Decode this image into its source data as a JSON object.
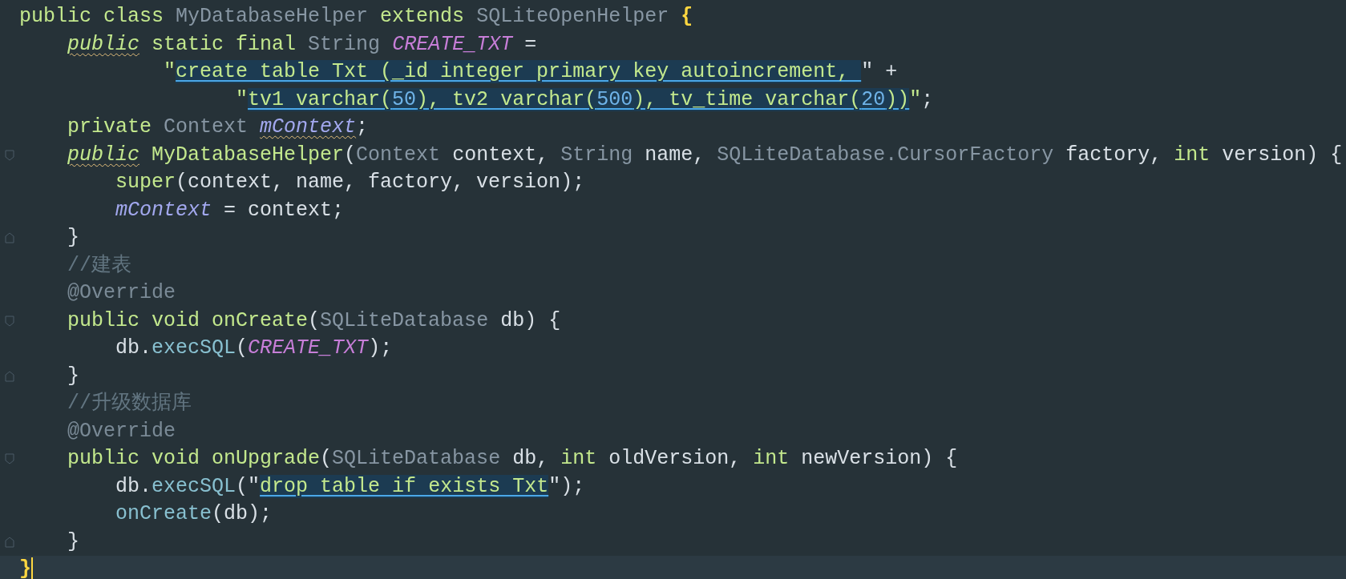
{
  "editor": {
    "lines": [
      {
        "kind": "code",
        "tokens": [
          {
            "text": "public class ",
            "kind": "keyword"
          },
          {
            "text": "MyDatabaseHelper ",
            "kind": "type"
          },
          {
            "text": "extends ",
            "kind": "keyword"
          },
          {
            "text": "SQLiteOpenHelper ",
            "kind": "type"
          },
          {
            "text": "{",
            "kind": "brace"
          }
        ]
      },
      {
        "kind": "code",
        "tokens": [
          {
            "text": "    public",
            "kind": "keyword-warning"
          },
          {
            "text": " static final ",
            "kind": "keyword"
          },
          {
            "text": "String ",
            "kind": "type"
          },
          {
            "text": "CREATE_TXT",
            "kind": "constant"
          },
          {
            "text": " =",
            "kind": "plain"
          }
        ]
      },
      {
        "kind": "code",
        "tokens": [
          {
            "text": "            \"",
            "kind": "string"
          },
          {
            "text": "create table Txt (_id integer primary key autoincrement, ",
            "kind": "sql"
          },
          {
            "text": "\" +",
            "kind": "plain"
          }
        ]
      },
      {
        "kind": "code",
        "tokens": [
          {
            "text": "                  \"",
            "kind": "string"
          },
          {
            "text": "tv1 varchar(",
            "kind": "sql"
          },
          {
            "text": "50",
            "kind": "sql-number"
          },
          {
            "text": "), tv2 varchar(",
            "kind": "sql"
          },
          {
            "text": "500",
            "kind": "sql-number"
          },
          {
            "text": "), tv_time varchar(",
            "kind": "sql"
          },
          {
            "text": "20",
            "kind": "sql-number"
          },
          {
            "text": "))",
            "kind": "sql"
          },
          {
            "text": "\"",
            "kind": "string"
          },
          {
            "text": ";",
            "kind": "plain"
          }
        ]
      },
      {
        "kind": "code",
        "tokens": [
          {
            "text": "    private ",
            "kind": "keyword"
          },
          {
            "text": "Context ",
            "kind": "type"
          },
          {
            "text": "mContext",
            "kind": "field-warning"
          },
          {
            "text": ";",
            "kind": "plain"
          }
        ]
      },
      {
        "kind": "fold-start",
        "tokens": [
          {
            "text": "    public",
            "kind": "keyword-warning"
          },
          {
            "text": " MyDatabaseHelper",
            "kind": "keyword"
          },
          {
            "text": "(",
            "kind": "plain"
          },
          {
            "text": "Context ",
            "kind": "type"
          },
          {
            "text": "context, ",
            "kind": "plain"
          },
          {
            "text": "String ",
            "kind": "type"
          },
          {
            "text": "name, ",
            "kind": "plain"
          },
          {
            "text": "SQLiteDatabase.CursorFactory ",
            "kind": "type"
          },
          {
            "text": "factory, ",
            "kind": "plain"
          },
          {
            "text": "int ",
            "kind": "keyword"
          },
          {
            "text": "version) {",
            "kind": "plain"
          }
        ]
      },
      {
        "kind": "code",
        "tokens": [
          {
            "text": "        super",
            "kind": "keyword"
          },
          {
            "text": "(context, name, factory, version);",
            "kind": "plain"
          }
        ]
      },
      {
        "kind": "code",
        "tokens": [
          {
            "text": "        mContext",
            "kind": "field"
          },
          {
            "text": " = context;",
            "kind": "plain"
          }
        ]
      },
      {
        "kind": "fold-end",
        "tokens": [
          {
            "text": "    }",
            "kind": "plain"
          }
        ]
      },
      {
        "kind": "code",
        "tokens": [
          {
            "text": "    //建表",
            "kind": "comment"
          }
        ]
      },
      {
        "kind": "code",
        "tokens": [
          {
            "text": "    @Override",
            "kind": "annotation"
          }
        ]
      },
      {
        "kind": "fold-start",
        "tokens": [
          {
            "text": "    public void ",
            "kind": "keyword"
          },
          {
            "text": "onCreate",
            "kind": "keyword"
          },
          {
            "text": "(",
            "kind": "plain"
          },
          {
            "text": "SQLiteDatabase ",
            "kind": "type"
          },
          {
            "text": "db) {",
            "kind": "plain"
          }
        ]
      },
      {
        "kind": "code",
        "tokens": [
          {
            "text": "        db.",
            "kind": "plain"
          },
          {
            "text": "execSQL",
            "kind": "method"
          },
          {
            "text": "(",
            "kind": "plain"
          },
          {
            "text": "CREATE_TXT",
            "kind": "constant"
          },
          {
            "text": ");",
            "kind": "plain"
          }
        ]
      },
      {
        "kind": "fold-end",
        "tokens": [
          {
            "text": "    }",
            "kind": "plain"
          }
        ]
      },
      {
        "kind": "code",
        "tokens": [
          {
            "text": "    //升级数据库",
            "kind": "comment"
          }
        ]
      },
      {
        "kind": "code",
        "tokens": [
          {
            "text": "    @Override",
            "kind": "annotation"
          }
        ]
      },
      {
        "kind": "fold-start",
        "tokens": [
          {
            "text": "    public void ",
            "kind": "keyword"
          },
          {
            "text": "onUpgrade",
            "kind": "keyword"
          },
          {
            "text": "(",
            "kind": "plain"
          },
          {
            "text": "SQLiteDatabase ",
            "kind": "type"
          },
          {
            "text": "db, ",
            "kind": "plain"
          },
          {
            "text": "int ",
            "kind": "keyword"
          },
          {
            "text": "oldVersion, ",
            "kind": "plain"
          },
          {
            "text": "int ",
            "kind": "keyword"
          },
          {
            "text": "newVersion) {",
            "kind": "plain"
          }
        ]
      },
      {
        "kind": "code",
        "tokens": [
          {
            "text": "        db.",
            "kind": "plain"
          },
          {
            "text": "execSQL",
            "kind": "method"
          },
          {
            "text": "(\"",
            "kind": "plain"
          },
          {
            "text": "drop table if exists Txt",
            "kind": "sql"
          },
          {
            "text": "\");",
            "kind": "plain"
          }
        ]
      },
      {
        "kind": "code",
        "tokens": [
          {
            "text": "        onCreate",
            "kind": "method"
          },
          {
            "text": "(db);",
            "kind": "plain"
          }
        ]
      },
      {
        "kind": "fold-end",
        "tokens": [
          {
            "text": "    }",
            "kind": "plain"
          }
        ]
      },
      {
        "kind": "code",
        "current": true,
        "tokens": [
          {
            "text": "}",
            "kind": "brace"
          }
        ]
      }
    ]
  }
}
